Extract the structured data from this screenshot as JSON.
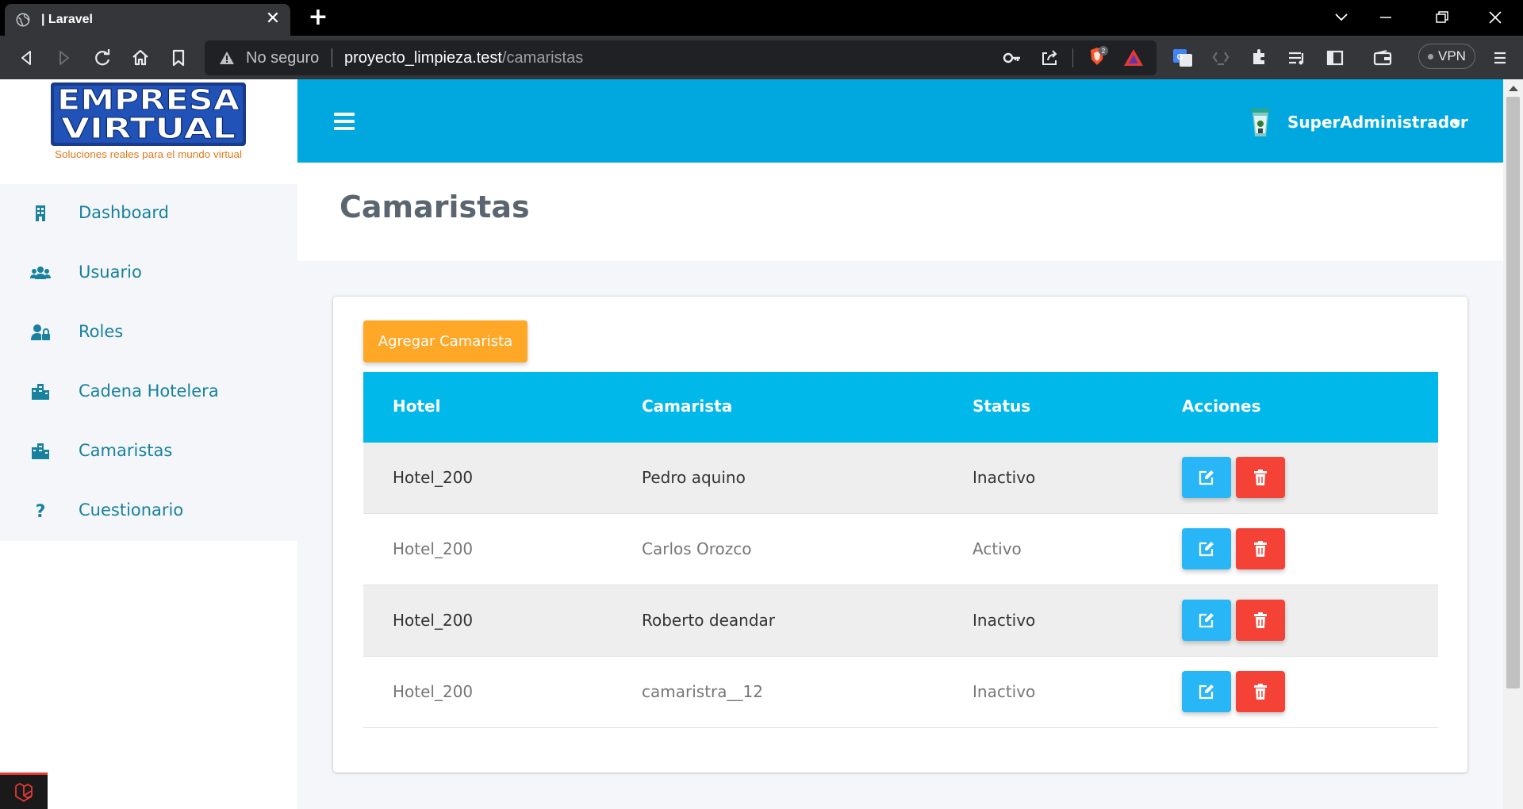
{
  "browser": {
    "tab_title": "| Laravel",
    "url_warning": "No seguro",
    "url_host": "proyecto_limpieza.test",
    "url_path": "/camaristas",
    "vpn_label": "VPN",
    "brave_badge": "2"
  },
  "sidebar": {
    "logo_text_top": "EMPRESA",
    "logo_text_bottom": "VIRTUAL",
    "logo_tagline": "Soluciones reales para el mundo virtual",
    "items": [
      {
        "label": "Dashboard",
        "icon": "building-icon"
      },
      {
        "label": "Usuario",
        "icon": "users-icon"
      },
      {
        "label": "Roles",
        "icon": "user-lock-icon"
      },
      {
        "label": "Cadena Hotelera",
        "icon": "city-icon"
      },
      {
        "label": "Camaristas",
        "icon": "city-icon"
      },
      {
        "label": "Cuestionario",
        "icon": "question-icon"
      }
    ]
  },
  "header": {
    "user_name": "SuperAdministrador"
  },
  "page": {
    "title": "Camaristas",
    "add_button": "Agregar Camarista"
  },
  "table": {
    "columns": [
      "Hotel",
      "Camarista",
      "Status",
      "Acciones"
    ],
    "rows": [
      {
        "hotel": "Hotel_200",
        "camarista": "Pedro aquino",
        "status": "Inactivo"
      },
      {
        "hotel": "Hotel_200",
        "camarista": "Carlos Orozco",
        "status": "Activo"
      },
      {
        "hotel": "Hotel_200",
        "camarista": "Roberto deandar",
        "status": "Inactivo"
      },
      {
        "hotel": "Hotel_200",
        "camarista": "camaristra__12",
        "status": "Inactivo"
      }
    ]
  },
  "colors": {
    "header": "#00a8df",
    "table_head": "#00b8ea",
    "add_button": "#ffa726",
    "edit_button": "#29b6f6",
    "delete_button": "#f44336",
    "nav_text": "#17819e"
  }
}
